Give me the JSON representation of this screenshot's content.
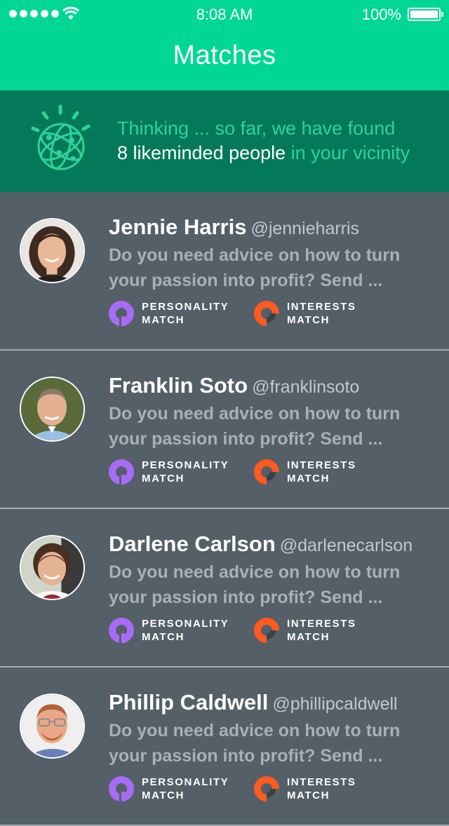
{
  "status_bar": {
    "time": "8:08 AM",
    "battery": "100%"
  },
  "header": {
    "title": "Matches"
  },
  "banner": {
    "line1": "Thinking ... so far, we have found",
    "line2_main": "8 likeminded people",
    "line2_accent": " in your vicinity",
    "logo_icon": "watson-globe-icon"
  },
  "colors": {
    "header_bg": "#00d793",
    "banner_bg": "#037959",
    "list_bg": "#545f68",
    "personality": "#a86bf5",
    "interests": "#ff5a1f"
  },
  "matches": [
    {
      "name": "Jennie Harris",
      "handle": "@jennieharris",
      "message": "Do you need advice on how to turn your passion into profit? Send ...",
      "personality_label": "PERSONALITY MATCH",
      "interests_label": "INTERESTS MATCH"
    },
    {
      "name": "Franklin Soto",
      "handle": "@franklinsoto",
      "message": "Do you need advice on how to turn your passion into profit? Send ...",
      "personality_label": "PERSONALITY MATCH",
      "interests_label": "INTERESTS MATCH"
    },
    {
      "name": "Darlene Carlson",
      "handle": "@darlenecarlson",
      "message": "Do you need advice on how to turn your passion into profit? Send ...",
      "personality_label": "PERSONALITY MATCH",
      "interests_label": "INTERESTS MATCH"
    },
    {
      "name": "Phillip Caldwell",
      "handle": "@phillipcaldwell",
      "message": "Do you need advice on how to turn your passion into profit? Send ...",
      "personality_label": "PERSONALITY MATCH",
      "interests_label": "INTERESTS MATCH"
    }
  ]
}
